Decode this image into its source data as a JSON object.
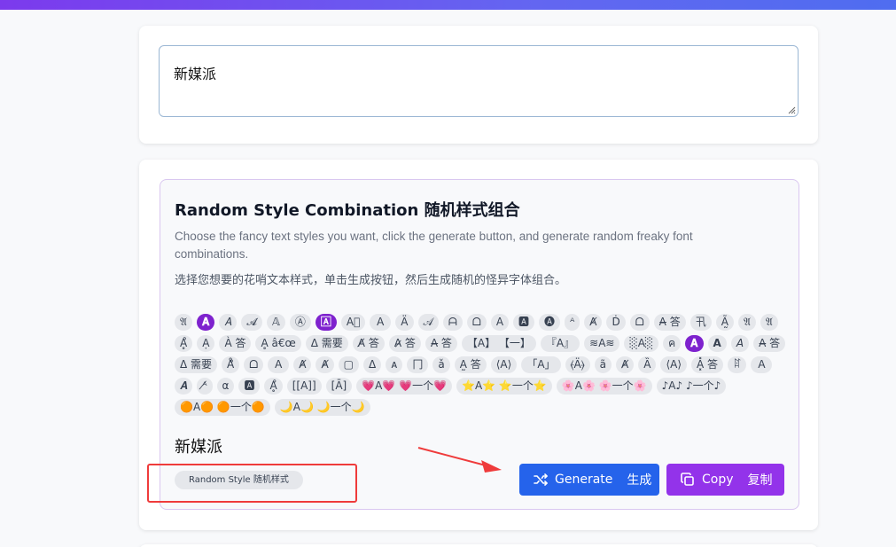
{
  "colors": {
    "accent_purple": "#7e22ce",
    "generate_blue": "#2563eb",
    "copy_purple": "#9333ea",
    "annotation_red": "#ef3b3b"
  },
  "input": {
    "value": "新媒派"
  },
  "panel": {
    "title": "Random Style Combination  随机样式组合",
    "description_en": "Choose the fancy text styles you want, click the generate button, and generate random freaky font combinations.",
    "description_zh": "选择您想要的花哨文本样式，单击生成按钮，然后生成随机的怪异字体组合。",
    "styles": [
      {
        "label": "𝔄",
        "selected": false
      },
      {
        "label": "𝐀",
        "selected": true
      },
      {
        "label": "𝐴",
        "selected": false
      },
      {
        "label": "𝓐",
        "selected": false
      },
      {
        "label": "𝔸",
        "selected": false
      },
      {
        "label": "Ⓐ",
        "selected": false
      },
      {
        "label": "🄰",
        "selected": true
      },
      {
        "label": "A⃞",
        "selected": false
      },
      {
        "label": "Ａ",
        "selected": false
      },
      {
        "label": "Ä",
        "selected": false
      },
      {
        "label": "𝒜",
        "selected": false
      },
      {
        "label": "ᗩ",
        "selected": false
      },
      {
        "label": "ᗝ",
        "selected": false
      },
      {
        "label": "A",
        "selected": false
      },
      {
        "label": "🅰",
        "selected": false
      },
      {
        "label": "🅐",
        "selected": false
      },
      {
        "label": "ᴬ",
        "selected": false
      },
      {
        "label": "Ⱥ",
        "selected": false
      },
      {
        "label": "Ḋ",
        "selected": false
      },
      {
        "label": "ᗝ",
        "selected": false
      },
      {
        "label": "A̶ 答",
        "selected": false
      },
      {
        "label": "卂",
        "selected": false
      },
      {
        "label": "Ã̰",
        "selected": false
      },
      {
        "label": "𝔄",
        "selected": false
      },
      {
        "label": "𝔄",
        "selected": false
      },
      {
        "label": "Ḁ̊",
        "selected": false
      },
      {
        "label": "Ạ",
        "selected": false
      },
      {
        "label": "À 答",
        "selected": false
      },
      {
        "label": "Ḁ â€œ",
        "selected": false
      },
      {
        "label": "Δ 需要",
        "selected": false
      },
      {
        "label": "A̸ 答",
        "selected": false
      },
      {
        "label": "A̷ 答",
        "selected": false
      },
      {
        "label": "A̶ 答",
        "selected": false
      },
      {
        "label": "【A】 【一】",
        "selected": false
      },
      {
        "label": "『A』",
        "selected": false
      },
      {
        "label": "≋A≋",
        "selected": false
      },
      {
        "label": "░A░",
        "selected": false
      },
      {
        "label": "ค",
        "selected": false
      },
      {
        "label": "𝐀",
        "selected": true
      },
      {
        "label": "𝗔",
        "selected": false
      },
      {
        "label": "𝘈",
        "selected": false
      },
      {
        "label": "A̶ 答",
        "selected": false
      },
      {
        "label": "Δ 需要",
        "selected": false
      },
      {
        "label": "Å̊",
        "selected": false
      },
      {
        "label": "ᗝ",
        "selected": false
      },
      {
        "label": "Ａ",
        "selected": false
      },
      {
        "label": "Ⱥ",
        "selected": false
      },
      {
        "label": "Ⱥ",
        "selected": false
      },
      {
        "label": "▢",
        "selected": false
      },
      {
        "label": "Δ",
        "selected": false
      },
      {
        "label": "ᴀ",
        "selected": false
      },
      {
        "label": "冂",
        "selected": false
      },
      {
        "label": "ǎ",
        "selected": false
      },
      {
        "label": "A̰ 答",
        "selected": false
      },
      {
        "label": "⟨A⟩",
        "selected": false
      },
      {
        "label": "「A」",
        "selected": false
      },
      {
        "label": "⦑Ä⦒",
        "selected": false
      },
      {
        "label": "ã",
        "selected": false
      },
      {
        "label": "Ⱥ",
        "selected": false
      },
      {
        "label": "Ȁ",
        "selected": false
      },
      {
        "label": "⟨A⟩",
        "selected": false
      },
      {
        "label": "A͓̽ 答",
        "selected": false
      },
      {
        "label": "ꍏ",
        "selected": false
      },
      {
        "label": "Ａ",
        "selected": false
      },
      {
        "label": "𝑨",
        "selected": false
      },
      {
        "label": "ᴬ̸",
        "selected": false
      },
      {
        "label": "α",
        "selected": false
      },
      {
        "label": "🅰",
        "selected": false
      },
      {
        "label": "Ḁ̊",
        "selected": false
      },
      {
        "label": "[[A]]",
        "selected": false
      },
      {
        "label": "[Ā]",
        "selected": false
      },
      {
        "label": "💗A💗 💗一个💗",
        "selected": false
      },
      {
        "label": "⭐A⭐ ⭐一个⭐",
        "selected": false
      },
      {
        "label": "🌸A🌸 🌸一个🌸",
        "selected": false
      },
      {
        "label": "♪A♪ ♪一个♪",
        "selected": false
      },
      {
        "label": "🟠A🟠 🟠一个🟠",
        "selected": false
      },
      {
        "label": "🌙A🌙 🌙一个🌙",
        "selected": false
      }
    ],
    "output": "新媒派",
    "style_pill": "Random Style  随机样式",
    "generate_label": "Generate",
    "generate_label_zh": "生成",
    "copy_label": "Copy",
    "copy_label_zh": "复制"
  }
}
